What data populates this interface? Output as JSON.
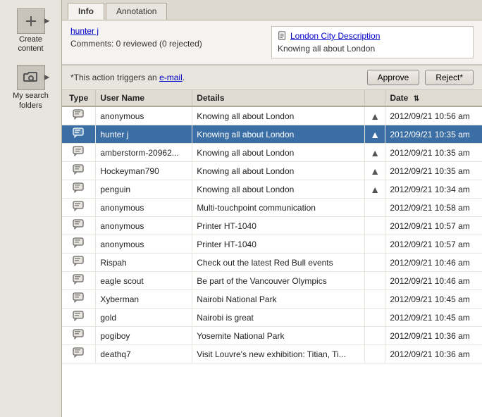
{
  "sidebar": {
    "items": [
      {
        "id": "create-content",
        "label": "Create content",
        "icon": "plus-icon"
      },
      {
        "id": "my-search-folders",
        "label": "My search folders",
        "icon": "folder-search-icon"
      }
    ]
  },
  "tabs": [
    {
      "id": "info",
      "label": "Info",
      "active": true
    },
    {
      "id": "annotation",
      "label": "Annotation",
      "active": false
    }
  ],
  "info_panel": {
    "user_link": "hunter j",
    "comments": "Comments: 0 reviewed (0 rejected)",
    "doc_title": "London City Description",
    "doc_description": "Knowing all about London"
  },
  "action_bar": {
    "text_prefix": "*This action triggers an ",
    "email_link": "e-mail",
    "text_suffix": ".",
    "approve_button": "Approve",
    "reject_button": "Reject*"
  },
  "table": {
    "columns": [
      {
        "id": "type",
        "label": "Type"
      },
      {
        "id": "username",
        "label": "User Name"
      },
      {
        "id": "details",
        "label": "Details"
      },
      {
        "id": "arrow",
        "label": ""
      },
      {
        "id": "date",
        "label": "Date"
      }
    ],
    "rows": [
      {
        "type": "comment",
        "username": "anonymous",
        "details": "Knowing all about London",
        "has_arrow": true,
        "date": "2012/09/21 10:56 am",
        "selected": false
      },
      {
        "type": "comment",
        "username": "hunter j",
        "details": "Knowing all about London",
        "has_arrow": true,
        "date": "2012/09/21 10:35 am",
        "selected": true
      },
      {
        "type": "comment-small",
        "username": "amberstorm-20962...",
        "details": "Knowing all about London",
        "has_arrow": true,
        "date": "2012/09/21 10:35 am",
        "selected": false
      },
      {
        "type": "comment",
        "username": "Hockeyman790",
        "details": "Knowing all about London",
        "has_arrow": true,
        "date": "2012/09/21 10:35 am",
        "selected": false
      },
      {
        "type": "comment",
        "username": "penguin",
        "details": "Knowing all about London",
        "has_arrow": true,
        "date": "2012/09/21 10:34 am",
        "selected": false
      },
      {
        "type": "comment",
        "username": "anonymous",
        "details": "Multi-touchpoint communication",
        "has_arrow": false,
        "date": "2012/09/21 10:58 am",
        "selected": false
      },
      {
        "type": "comment",
        "username": "anonymous",
        "details": "Printer HT-1040",
        "has_arrow": false,
        "date": "2012/09/21 10:57 am",
        "selected": false
      },
      {
        "type": "comment",
        "username": "anonymous",
        "details": "Printer HT-1040",
        "has_arrow": false,
        "date": "2012/09/21 10:57 am",
        "selected": false
      },
      {
        "type": "comment",
        "username": "Rispah",
        "details": "Check out the latest Red Bull events",
        "has_arrow": false,
        "date": "2012/09/21 10:46 am",
        "selected": false
      },
      {
        "type": "comment",
        "username": "eagle scout",
        "details": "Be part of the Vancouver Olympics",
        "has_arrow": false,
        "date": "2012/09/21 10:46 am",
        "selected": false
      },
      {
        "type": "comment",
        "username": "Xyberman",
        "details": "Nairobi National Park",
        "has_arrow": false,
        "date": "2012/09/21 10:45 am",
        "selected": false
      },
      {
        "type": "comment",
        "username": "gold",
        "details": "Nairobi is great",
        "has_arrow": false,
        "date": "2012/09/21 10:45 am",
        "selected": false
      },
      {
        "type": "comment",
        "username": "pogiboy",
        "details": "Yosemite National Park",
        "has_arrow": false,
        "date": "2012/09/21 10:36 am",
        "selected": false
      },
      {
        "type": "comment",
        "username": "deathq7",
        "details": "Visit Louvre's new exhibition: Titian, Ti...",
        "has_arrow": false,
        "date": "2012/09/21 10:36 am",
        "selected": false
      }
    ]
  }
}
